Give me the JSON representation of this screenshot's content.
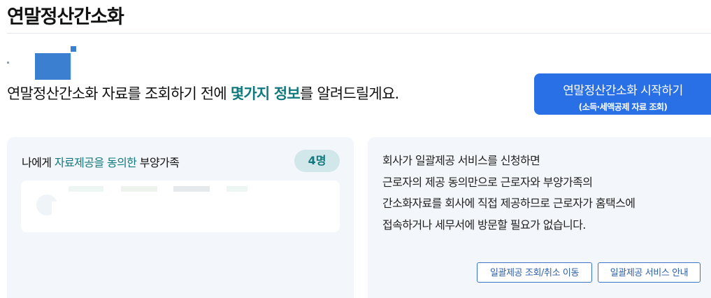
{
  "header": {
    "title": "연말정산간소화"
  },
  "intro": {
    "before": "연말정산간소화 자료를 조회하기 전에 ",
    "highlight": "몇가지 정보",
    "after": "를 알려드릴게요."
  },
  "start_button": {
    "label": "연말정산간소화 시작하기",
    "sublabel": "(소득·세액공제 자료 조회)",
    "color": "#2970e6"
  },
  "consent_card": {
    "label_before": "나에게 ",
    "label_highlight": "자료제공을 동의한",
    "label_after": " 부양가족",
    "count": "4명",
    "accent_color": "#11797d"
  },
  "info_card": {
    "lines": [
      "회사가 일괄제공 서비스를 신청하면",
      "근로자의 제공 동의만으로 근로자와 부양가족의",
      "간소화자료를 회사에 직접 제공하므로 근로자가 홈택스에",
      "접속하거나 세무서에 방문할 필요가 없습니다."
    ],
    "buttons": [
      "일괄제공 조회/취소 이동",
      "일괄제공 서비스 안내"
    ]
  }
}
